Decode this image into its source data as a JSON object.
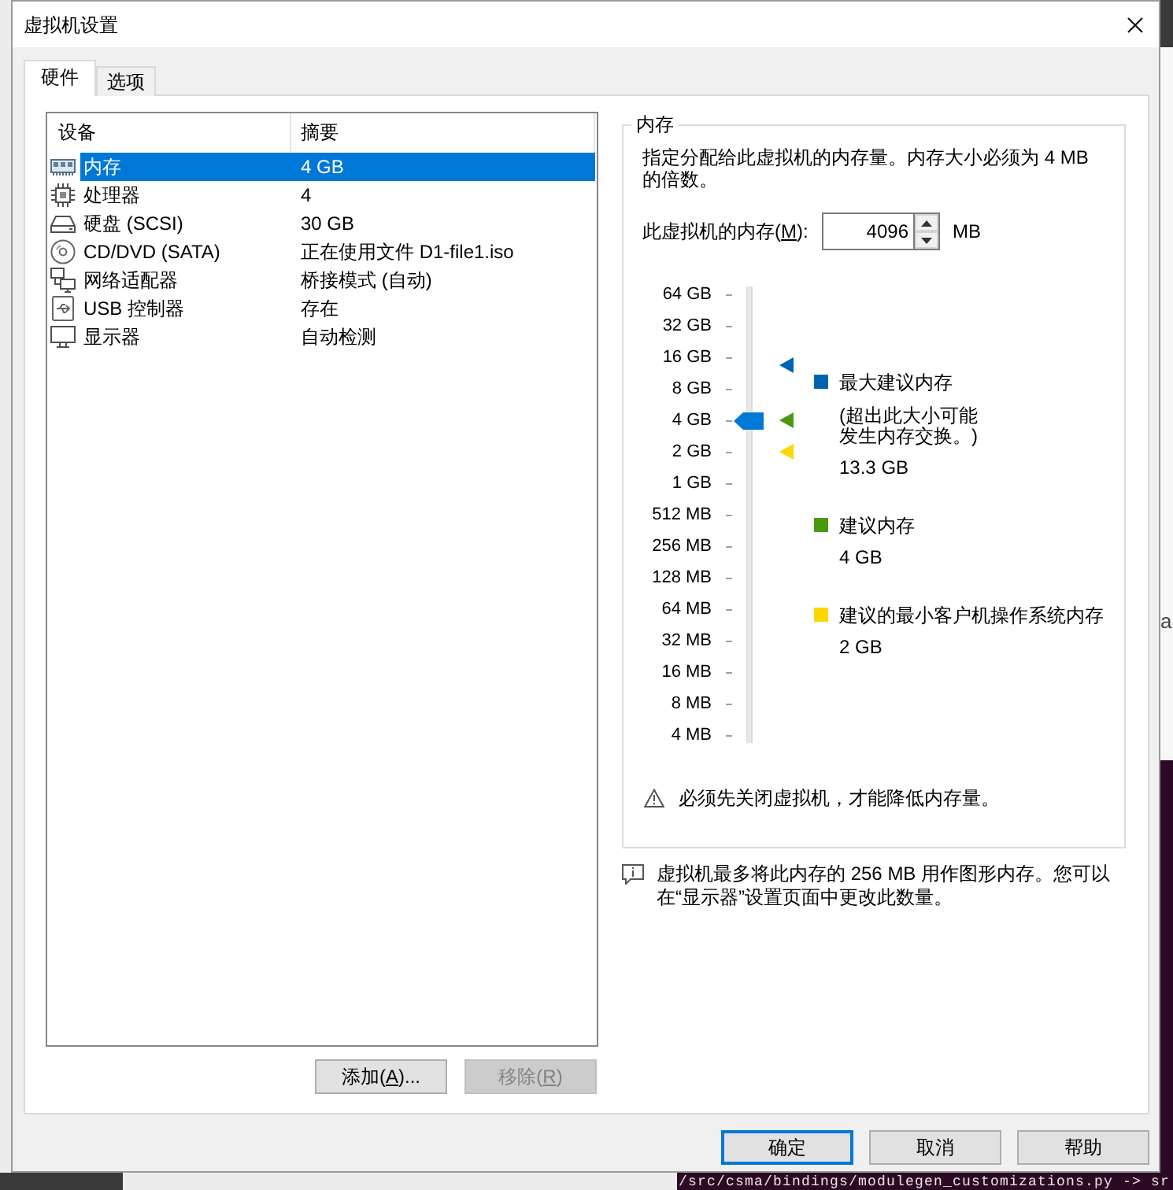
{
  "window": {
    "title": "虚拟机设置"
  },
  "tabs": [
    {
      "label": "硬件",
      "selected": true
    },
    {
      "label": "选项",
      "selected": false
    }
  ],
  "device_list": {
    "columns": [
      "设备",
      "摘要"
    ],
    "rows": [
      {
        "kind": "memory",
        "device": "内存",
        "summary": "4 GB",
        "selected": true
      },
      {
        "kind": "processor",
        "device": "处理器",
        "summary": "4",
        "selected": false
      },
      {
        "kind": "disk",
        "device": "硬盘 (SCSI)",
        "summary": "30 GB",
        "selected": false
      },
      {
        "kind": "cdrom",
        "device": "CD/DVD (SATA)",
        "summary": "正在使用文件 D1-file1.iso",
        "selected": false
      },
      {
        "kind": "network",
        "device": "网络适配器",
        "summary": "桥接模式 (自动)",
        "selected": false
      },
      {
        "kind": "usb",
        "device": "USB 控制器",
        "summary": "存在",
        "selected": false
      },
      {
        "kind": "display",
        "device": "显示器",
        "summary": "自动检测",
        "selected": false
      }
    ]
  },
  "list_buttons": [
    {
      "label": [
        {
          "text": "添加(",
          "underline": false
        },
        {
          "text": "A",
          "underline": true
        },
        {
          "text": ")...",
          "underline": false
        }
      ],
      "disabled": false
    },
    {
      "label": [
        {
          "text": "移除(",
          "underline": false
        },
        {
          "text": "R",
          "underline": true
        },
        {
          "text": ")",
          "underline": false
        }
      ],
      "disabled": true
    }
  ],
  "memory": {
    "legend": "内存",
    "description": "指定分配给此虚拟机的内存量。内存大小必须为 4 MB 的倍数。",
    "field": {
      "label": [
        {
          "text": "此虚拟机的内存(",
          "underline": false
        },
        {
          "text": "M",
          "underline": true
        },
        {
          "text": "):",
          "underline": false
        }
      ],
      "value": "4096",
      "unit": "MB"
    },
    "scale": {
      "ticks": [
        "64 GB",
        "32 GB",
        "16 GB",
        "8 GB",
        "4 GB",
        "2 GB",
        "1 GB",
        "512 MB",
        "256 MB",
        "128 MB",
        "64 MB",
        "32 MB",
        "16 MB",
        "8 MB",
        "4 MB"
      ],
      "level": 0.714,
      "markers": [
        {
          "color": "#0063b1",
          "level": 0.838
        },
        {
          "color": "#4b9a0e",
          "level": 0.714
        },
        {
          "color": "#fcd700",
          "level": 0.643
        }
      ]
    },
    "recommendations": [
      {
        "color": "#0063b1",
        "title": "最大建议内存",
        "note": "(超出此大小可能发生内存交换。)",
        "value": "13.3 GB"
      },
      {
        "color": "#4b9a0e",
        "title": "建议内存",
        "value": "4 GB"
      },
      {
        "color": "#fcd700",
        "title": "建议的最小客户机操作系统内存",
        "value": "2 GB"
      }
    ],
    "warning": "必须先关闭虚拟机，才能降低内存量。"
  },
  "info": "虚拟机最多将此内存的 256 MB 用作图形内存。您可以在“显示器”设置页面中更改此数量。",
  "dialog_buttons": [
    {
      "label": "确定",
      "default": true
    },
    {
      "label": "取消",
      "default": false
    },
    {
      "label": "帮助",
      "default": false
    }
  ],
  "background": {
    "window_text": "a",
    "terminal_line": "/src/csma/bindings/modulegen_customizations.py -> sr"
  }
}
